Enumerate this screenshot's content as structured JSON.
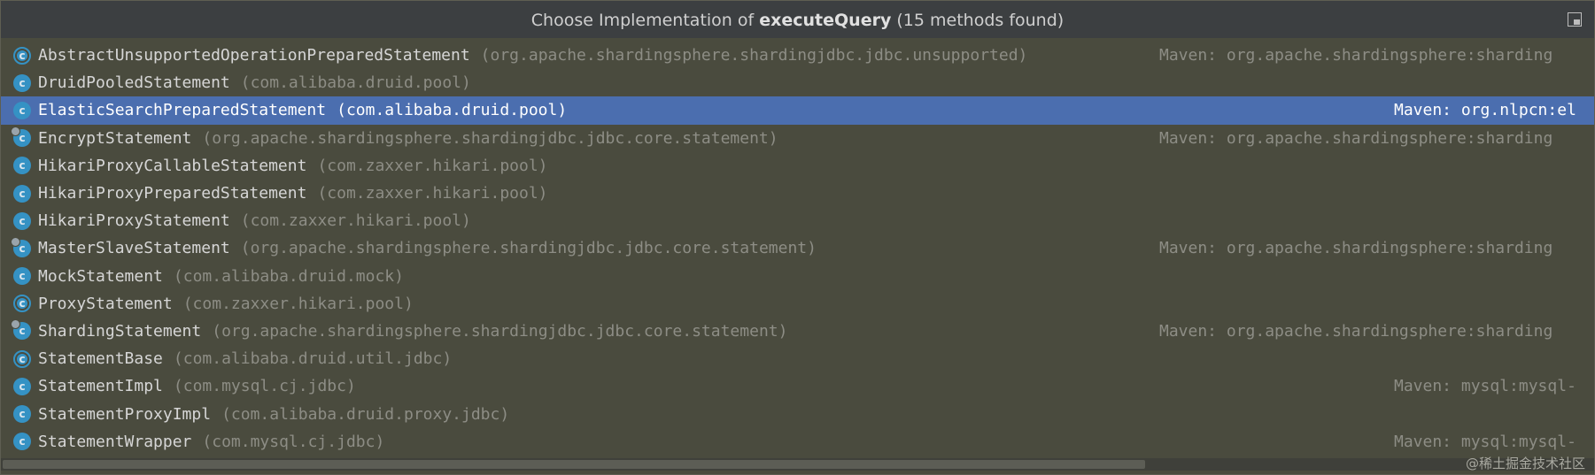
{
  "title": {
    "prefix": "Choose Implementation of ",
    "method": "executeQuery",
    "suffix": " (15 methods found)"
  },
  "watermark": "@稀土掘金技术社区",
  "colors": {
    "background": "#4a4b3e",
    "selection": "#4b6eaf",
    "class_icon": "#3592c4"
  },
  "items": [
    {
      "name": "AbstractUnsupportedOperationPreparedStatement",
      "package": "(org.apache.shardingsphere.shardingjdbc.jdbc.unsupported)",
      "location": "Maven: org.apache.shardingsphere:sharding",
      "icon": "abstract-class-icon"
    },
    {
      "name": "DruidPooledStatement",
      "package": "(com.alibaba.druid.pool)",
      "location": "",
      "icon": "class-icon"
    },
    {
      "name": "ElasticSearchPreparedStatement",
      "package": "(com.alibaba.druid.pool)",
      "location": "Maven: org.nlpcn:el",
      "icon": "class-icon",
      "selected": true
    },
    {
      "name": "EncryptStatement",
      "package": "(org.apache.shardingsphere.shardingjdbc.jdbc.core.statement)",
      "location": "Maven: org.apache.shardingsphere:sharding",
      "icon": "locked-class-icon"
    },
    {
      "name": "HikariProxyCallableStatement",
      "package": "(com.zaxxer.hikari.pool)",
      "location": "",
      "icon": "class-icon"
    },
    {
      "name": "HikariProxyPreparedStatement",
      "package": "(com.zaxxer.hikari.pool)",
      "location": "",
      "icon": "class-icon"
    },
    {
      "name": "HikariProxyStatement",
      "package": "(com.zaxxer.hikari.pool)",
      "location": "",
      "icon": "class-icon"
    },
    {
      "name": "MasterSlaveStatement",
      "package": "(org.apache.shardingsphere.shardingjdbc.jdbc.core.statement)",
      "location": "Maven: org.apache.shardingsphere:sharding",
      "icon": "locked-class-icon"
    },
    {
      "name": "MockStatement",
      "package": "(com.alibaba.druid.mock)",
      "location": "",
      "icon": "class-icon"
    },
    {
      "name": "ProxyStatement",
      "package": "(com.zaxxer.hikari.pool)",
      "location": "",
      "icon": "abstract-class-icon"
    },
    {
      "name": "ShardingStatement",
      "package": "(org.apache.shardingsphere.shardingjdbc.jdbc.core.statement)",
      "location": "Maven: org.apache.shardingsphere:sharding",
      "icon": "locked-class-icon"
    },
    {
      "name": "StatementBase",
      "package": "(com.alibaba.druid.util.jdbc)",
      "location": "",
      "icon": "abstract-class-icon"
    },
    {
      "name": "StatementImpl",
      "package": "(com.mysql.cj.jdbc)",
      "location": "Maven: mysql:mysql-",
      "icon": "class-icon"
    },
    {
      "name": "StatementProxyImpl",
      "package": "(com.alibaba.druid.proxy.jdbc)",
      "location": "",
      "icon": "class-icon"
    },
    {
      "name": "StatementWrapper",
      "package": "(com.mysql.cj.jdbc)",
      "location": "Maven: mysql:mysql-",
      "icon": "class-icon"
    }
  ]
}
